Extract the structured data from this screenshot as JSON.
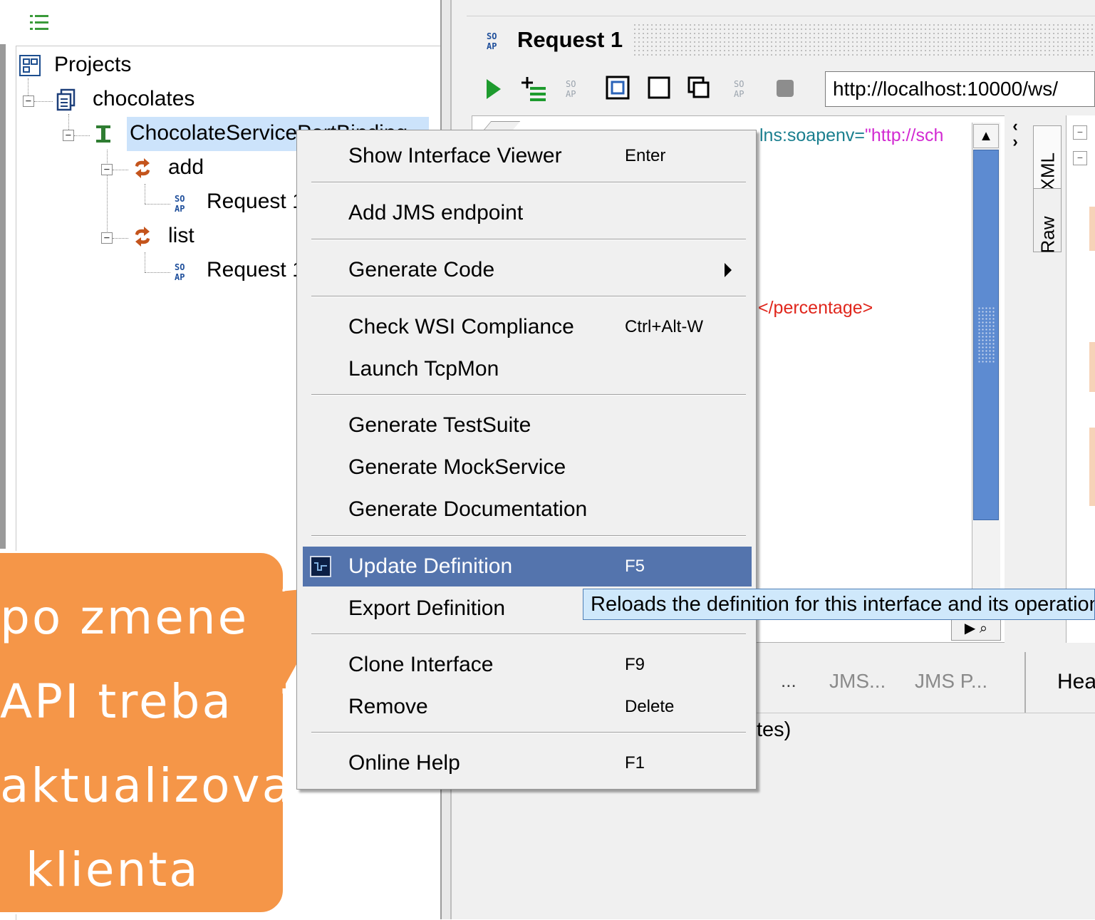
{
  "navigator": {
    "tree": {
      "root_label": "Projects",
      "project_label": "chocolates",
      "interface_label": "ChocolateServicePortBinding",
      "operations": [
        {
          "label": "add",
          "request_label": "Request 1"
        },
        {
          "label": "list",
          "request_label": "Request 1"
        }
      ]
    }
  },
  "editor": {
    "title": "Request 1",
    "endpoint_value": "http://localhost:10000/ws/",
    "xml_visible": {
      "namespace_fragment": "lns:soapenv=",
      "namespace_value": "\"http://sch",
      "closing_tag": "</percentage>"
    },
    "side_tabs": [
      "XML",
      "Raw"
    ],
    "bottom_tabs": [
      "...",
      "JMS...",
      "JMS P..."
    ],
    "right_tab": "Hea",
    "status_fragment": "tes)"
  },
  "context_menu": {
    "items": [
      {
        "label": "Show Interface Viewer",
        "shortcut": "Enter"
      },
      {
        "label": "Add JMS endpoint",
        "shortcut": ""
      },
      {
        "label": "Generate Code",
        "shortcut": "",
        "submenu": true
      },
      {
        "label": "Check WSI Compliance",
        "shortcut": "Ctrl+Alt-W"
      },
      {
        "label": "Launch TcpMon",
        "shortcut": ""
      },
      {
        "label": "Generate TestSuite",
        "shortcut": ""
      },
      {
        "label": "Generate MockService",
        "shortcut": ""
      },
      {
        "label": "Generate Documentation",
        "shortcut": ""
      },
      {
        "label": "Update Definition",
        "shortcut": "F5",
        "highlighted": true
      },
      {
        "label": "Export Definition",
        "shortcut": ""
      },
      {
        "label": "Clone Interface",
        "shortcut": "F9"
      },
      {
        "label": "Remove",
        "shortcut": "Delete"
      },
      {
        "label": "Online Help",
        "shortcut": "F1"
      }
    ]
  },
  "tooltip": {
    "text": "Reloads the definition for this interface and its operations"
  },
  "callout": {
    "lines": [
      "po zmene",
      "API treba",
      "aktualizovat'",
      "klienta"
    ]
  },
  "colors": {
    "menu_highlight": "#5474ad",
    "tooltip_bg": "#cfe8fb",
    "callout_bg": "#f59648",
    "selection_bg": "#cce3fb",
    "scroll_thumb": "#5d8bd1"
  },
  "icons": [
    "projects-icon",
    "project-icon",
    "interface-icon",
    "operation-icon",
    "soap-request-icon",
    "run-icon",
    "add-step-icon",
    "update-definition-icon",
    "submenu-arrow-icon"
  ]
}
